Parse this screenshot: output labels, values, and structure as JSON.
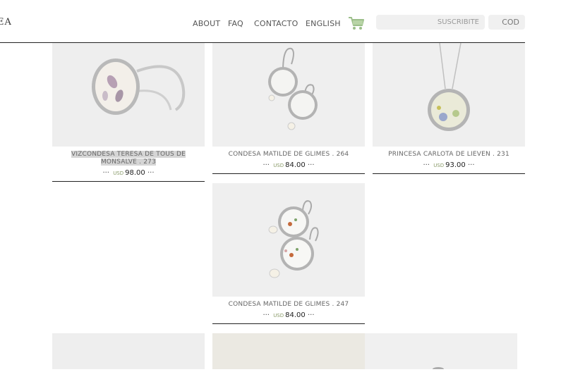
{
  "header": {
    "logo": "EA",
    "nav": [
      {
        "label": "ABOUT"
      },
      {
        "label": "FAQ"
      },
      {
        "label": "CONTACTO"
      },
      {
        "label": "ENGLISH"
      }
    ],
    "search_placeholder": "SUSCRIBITE",
    "code_label": "COD"
  },
  "products": [
    {
      "title": "VIZCONDESA TERESA DE TOUS DE MONSALVE . 273",
      "currency": "USD",
      "price": "98.00",
      "dots_left": "···",
      "dots_right": "···",
      "image": "bracelet"
    },
    {
      "title": "CONDESA MATILDE DE GLIMES . 264",
      "currency": "USD",
      "price": "84.00",
      "dots_left": "···",
      "dots_right": "···",
      "image": "earrings-white"
    },
    {
      "title": "PRINCESA CARLOTA DE LIEVEN . 231",
      "currency": "USD",
      "price": "93.00",
      "dots_left": "···",
      "dots_right": "···",
      "image": "pendant"
    },
    {
      "title": "CONDESA MATILDE DE GLIMES . 247",
      "currency": "USD",
      "price": "84.00",
      "dots_left": "···",
      "dots_right": "···",
      "image": "earrings-floral"
    }
  ]
}
